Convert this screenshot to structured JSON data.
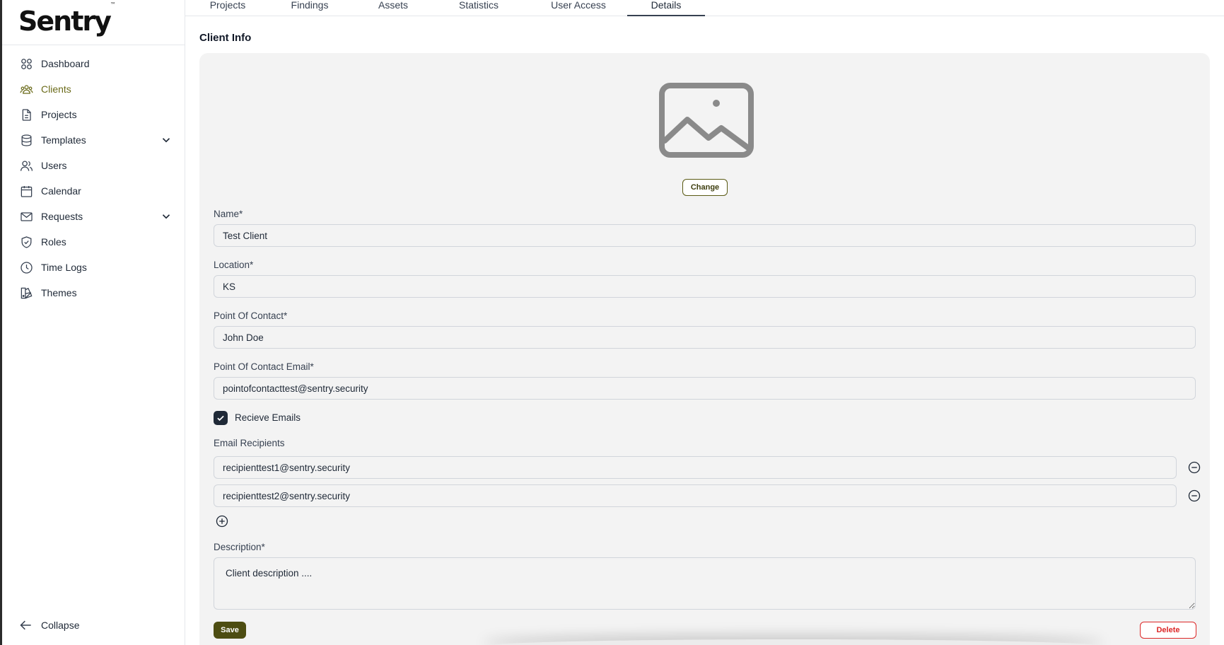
{
  "app": {
    "logo_text": "Sentry",
    "logo_mark": "™"
  },
  "sidebar": {
    "items": [
      {
        "label": "Dashboard",
        "icon": "grid-icon"
      },
      {
        "label": "Clients",
        "icon": "users-group-icon",
        "active": true
      },
      {
        "label": "Projects",
        "icon": "file-icon"
      },
      {
        "label": "Templates",
        "icon": "database-icon",
        "expandable": true
      },
      {
        "label": "Users",
        "icon": "users-icon"
      },
      {
        "label": "Calendar",
        "icon": "calendar-icon"
      },
      {
        "label": "Requests",
        "icon": "mail-icon",
        "expandable": true
      },
      {
        "label": "Roles",
        "icon": "shield-check-icon"
      },
      {
        "label": "Time Logs",
        "icon": "clock-icon"
      },
      {
        "label": "Themes",
        "icon": "palette-icon"
      }
    ],
    "collapse_label": "Collapse",
    "active_color": "#6b6b1a"
  },
  "tabs": [
    {
      "label": "Projects"
    },
    {
      "label": "Findings"
    },
    {
      "label": "Assets"
    },
    {
      "label": "Statistics"
    },
    {
      "label": "User Access"
    },
    {
      "label": "Details",
      "active": true
    }
  ],
  "main": {
    "section_title": "Client Info",
    "change_label": "Change",
    "fields": {
      "name": {
        "label": "Name*",
        "value": "Test Client"
      },
      "location": {
        "label": "Location*",
        "value": "KS"
      },
      "poc": {
        "label": "Point Of Contact*",
        "value": "John Doe"
      },
      "poc_email": {
        "label": "Point Of Contact Email*",
        "value": "pointofcontacttest@sentry.security"
      }
    },
    "receive_emails": {
      "label": "Recieve Emails",
      "checked": true
    },
    "email_recipients": {
      "label": "Email Recipients",
      "items": [
        "recipienttest1@sentry.security",
        "recipienttest2@sentry.security"
      ]
    },
    "description": {
      "label": "Description*",
      "value": "Client description ...."
    },
    "save_label": "Save",
    "delete_label": "Delete",
    "colors": {
      "primary": "#4d4d12",
      "danger": "#dc2626"
    }
  }
}
